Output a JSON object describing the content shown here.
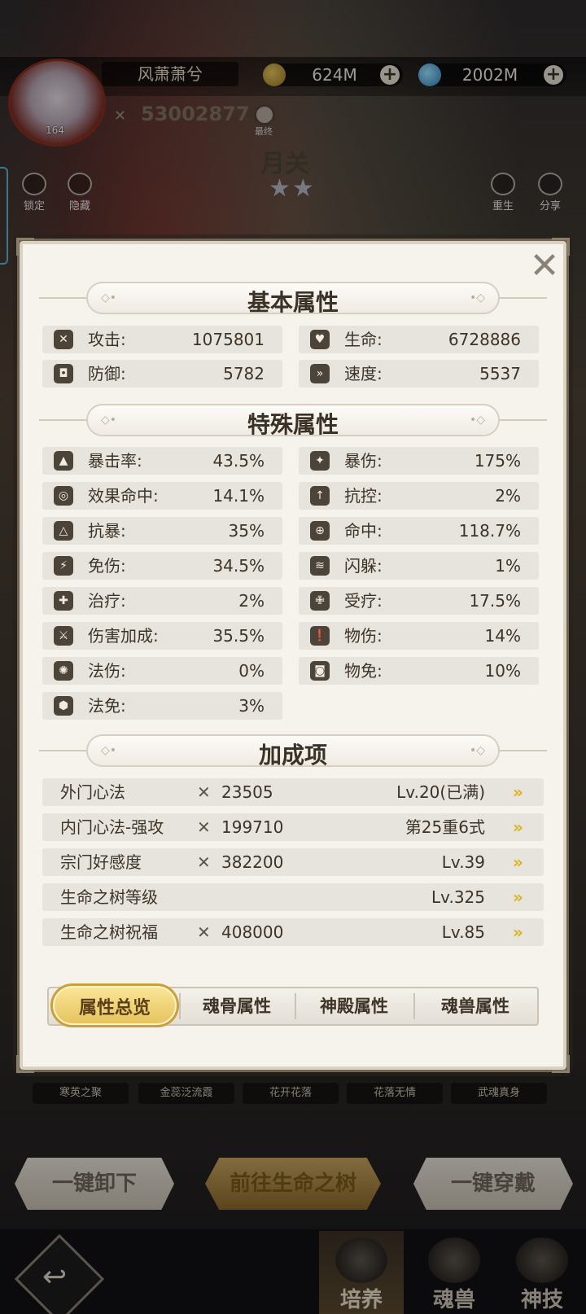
{
  "header": {
    "player_name": "风萧萧兮",
    "avatar_level": "164",
    "coins": "624M",
    "gems": "2002M",
    "power": "53002877",
    "search_label": "最终",
    "hero_name": "月关",
    "stars": "★★",
    "lock_label": "锁定",
    "hide_label": "隐藏",
    "rebirth_label": "重生",
    "share_label": "分享"
  },
  "modal": {
    "basic_title": "基本属性",
    "basic": [
      {
        "label": "攻击:",
        "value": "1075801"
      },
      {
        "label": "生命:",
        "value": "6728886"
      },
      {
        "label": "防御:",
        "value": "5782"
      },
      {
        "label": "速度:",
        "value": "5537"
      }
    ],
    "special_title": "特殊属性",
    "special": [
      {
        "label": "暴击率:",
        "value": "43.5%"
      },
      {
        "label": "暴伤:",
        "value": "175%"
      },
      {
        "label": "效果命中:",
        "value": "14.1%"
      },
      {
        "label": "抗控:",
        "value": "2%"
      },
      {
        "label": "抗暴:",
        "value": "35%"
      },
      {
        "label": "命中:",
        "value": "118.7%"
      },
      {
        "label": "免伤:",
        "value": "34.5%"
      },
      {
        "label": "闪躲:",
        "value": "1%"
      },
      {
        "label": "治疗:",
        "value": "2%"
      },
      {
        "label": "受疗:",
        "value": "17.5%"
      },
      {
        "label": "伤害加成:",
        "value": "35.5%"
      },
      {
        "label": "物伤:",
        "value": "14%"
      },
      {
        "label": "法伤:",
        "value": "0%"
      },
      {
        "label": "物免:",
        "value": "10%"
      },
      {
        "label": "法免:",
        "value": "3%"
      }
    ],
    "bonus_title": "加成项",
    "bonus": [
      {
        "name": "外门心法",
        "power": "23505",
        "level": "Lv.20(已满)"
      },
      {
        "name": "内门心法-强攻",
        "power": "199710",
        "level": "第25重6式"
      },
      {
        "name": "宗门好感度",
        "power": "382200",
        "level": "Lv.39"
      },
      {
        "name": "生命之树等级",
        "power": "",
        "level": "Lv.325"
      },
      {
        "name": "生命之树祝福",
        "power": "408000",
        "level": "Lv.85"
      }
    ],
    "tabs": [
      "属性总览",
      "魂骨属性",
      "神殿属性",
      "魂兽属性"
    ]
  },
  "skills": [
    "寒英之聚",
    "金蕊泛流霞",
    "花开花落",
    "花落无情",
    "武魂真身"
  ],
  "actions": {
    "unequip": "一键卸下",
    "goto_tree": "前往生命之树",
    "equip": "一键穿戴"
  },
  "nav": {
    "back_glyph": "↩",
    "tab_cultivate": "培养",
    "tab_beast": "魂兽",
    "tab_skill": "神技"
  }
}
